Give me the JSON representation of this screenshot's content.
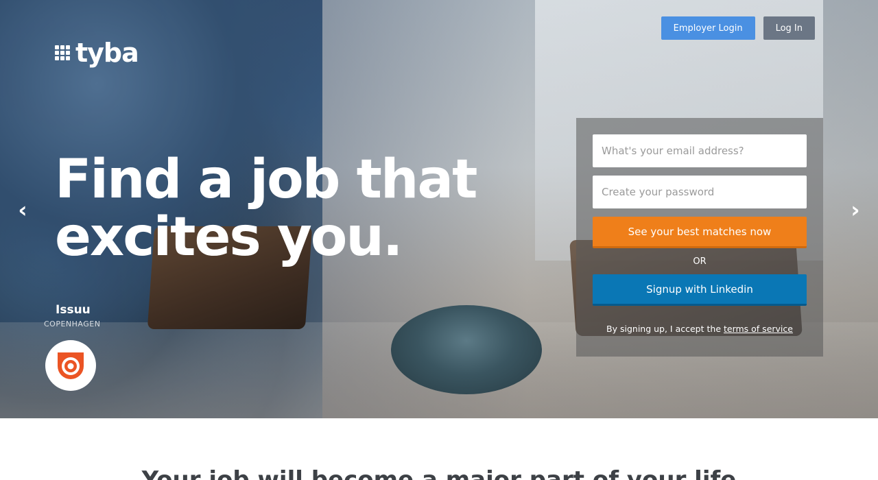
{
  "header": {
    "logo_text": "tyba",
    "employer_login_label": "Employer Login",
    "login_label": "Log In"
  },
  "hero": {
    "headline_line1": "Find a job that",
    "headline_line2": "excites you.",
    "company_name": "Issuu",
    "company_city": "COPENHAGEN",
    "prev_arrow": "‹",
    "next_arrow": "›"
  },
  "signup": {
    "email_placeholder": "What's your email address?",
    "password_placeholder": "Create your password",
    "cta_label": "See your best matches now",
    "or_label": "OR",
    "linkedin_label": "Signup with Linkedin",
    "terms_prefix": "By signing up, I accept the ",
    "terms_link": "terms of service"
  },
  "section": {
    "title": "Your job will become a major part of your life"
  },
  "colors": {
    "employer_button": "#4a90e2",
    "login_button": "#6b7685",
    "cta_orange": "#ef7f1a",
    "linkedin_blue": "#0a77b5",
    "issuu_red": "#eb5424"
  },
  "icons": {
    "logo": "grid-dots-icon",
    "prev": "chevron-left-icon",
    "next": "chevron-right-icon",
    "company": "issuu-logo-icon"
  }
}
